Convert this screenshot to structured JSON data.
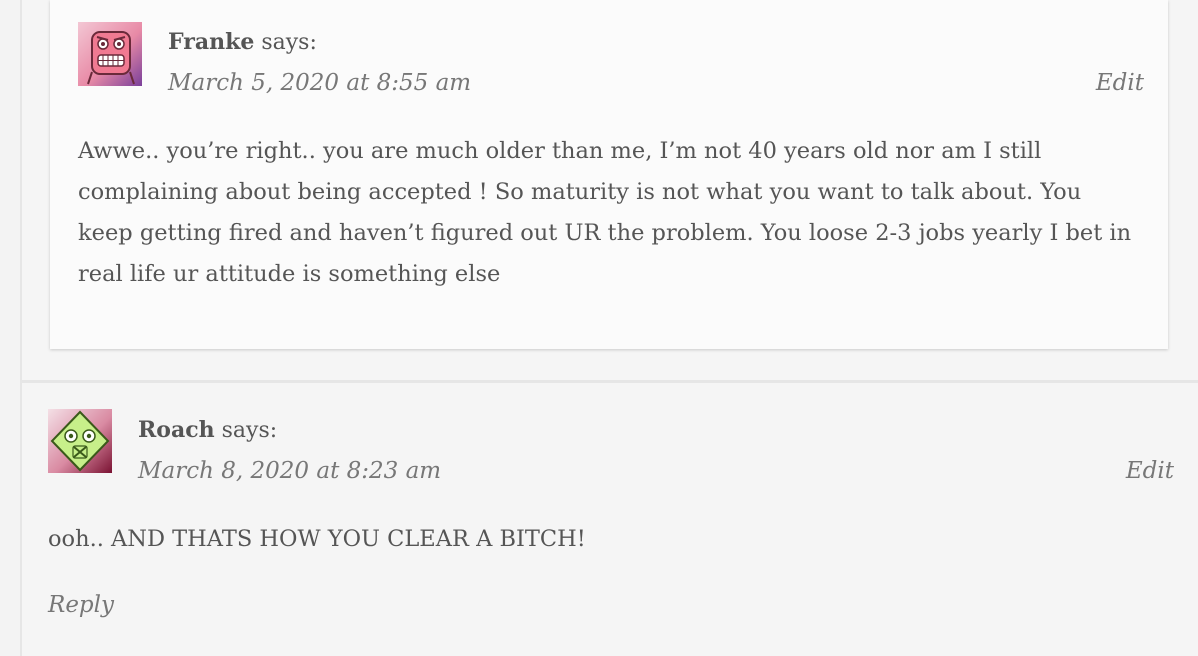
{
  "comments": [
    {
      "author": "Franke",
      "says": "says:",
      "date": "March 5, 2020 at 8:55 am",
      "edit_label": "Edit",
      "avatar_icon": "angry-face-avatar-icon",
      "avatar_colors": {
        "bg": "#f7a0b4",
        "accent": "#8a4a9c"
      },
      "body": "Awwe.. you’re right.. you are much older than me, I’m not 40 years old nor am I still complaining about being accepted ! So maturity is not what you want to talk about. You keep getting fired and haven’t figured out UR the problem. You loose 2-3 jobs yearly I bet in real life ur attitude is something else"
    },
    {
      "author": "Roach",
      "says": "says:",
      "date": "March 8, 2020 at 8:23 am",
      "edit_label": "Edit",
      "avatar_icon": "monster-face-avatar-icon",
      "avatar_colors": {
        "bg": "#d9f2b0",
        "accent": "#8b1a3a"
      },
      "body": "ooh.. AND THATS HOW YOU CLEAR A BITCH!",
      "reply_label": "Reply"
    }
  ]
}
